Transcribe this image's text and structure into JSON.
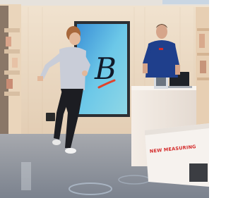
{
  "photo": {
    "counter_text": "NEW MEASURING",
    "screen_glyph": "B",
    "colors": {
      "wall": "#e9d6bf",
      "floor": "#8d929d",
      "screen": "#5fc0de",
      "shirt_staff": "#1f3f8c",
      "shirt_runner": "#c9cdd8",
      "counter": "#f2ece6",
      "counter_text": "#d42a2a"
    }
  }
}
